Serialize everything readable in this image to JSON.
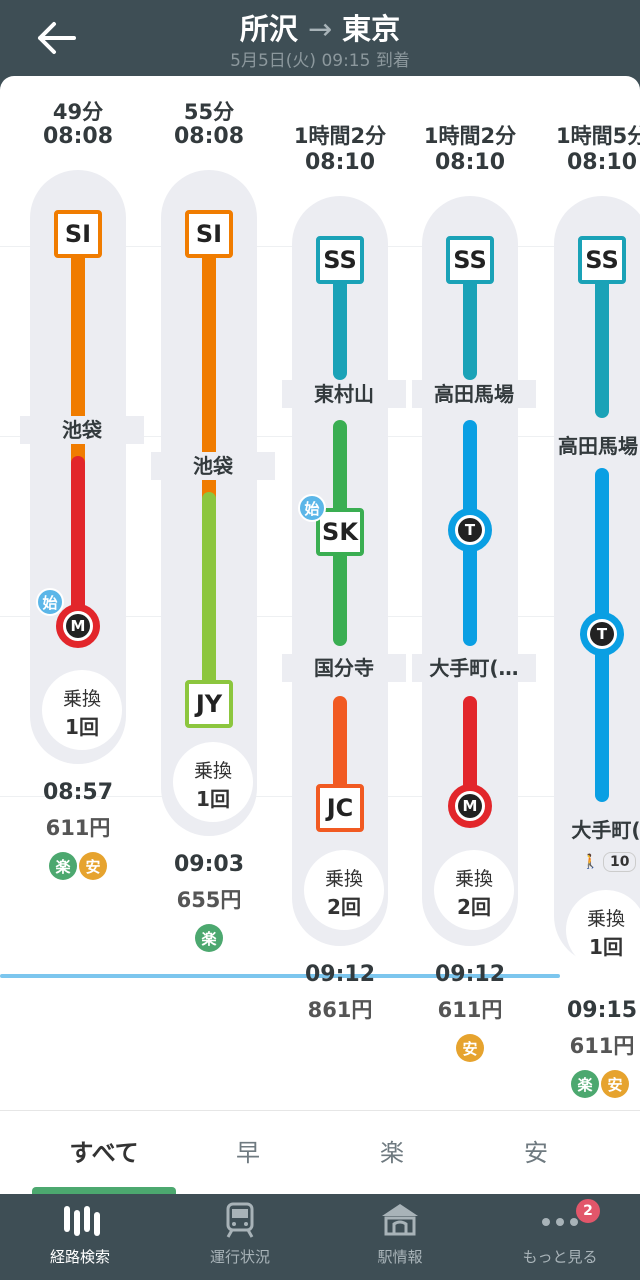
{
  "header": {
    "from": "所沢",
    "to": "東京",
    "arrow": "→",
    "subline": "5月5日(火) 09:15 到着"
  },
  "routes": [
    {
      "duration": "49分",
      "depart": "08:08",
      "badges": [
        "SI",
        "M"
      ],
      "stations": [
        "池袋"
      ],
      "shi": "始",
      "transfer_label": "乗換",
      "transfer_count": "1回",
      "arrive": "08:57",
      "fare": "611円",
      "tags": [
        "楽",
        "安"
      ]
    },
    {
      "duration": "55分",
      "depart": "08:08",
      "badges": [
        "SI",
        "JY"
      ],
      "stations": [
        "池袋"
      ],
      "transfer_label": "乗換",
      "transfer_count": "1回",
      "arrive": "09:03",
      "fare": "655円",
      "tags": [
        "楽"
      ]
    },
    {
      "duration": "1時間2分",
      "depart": "08:10",
      "badges": [
        "SS",
        "SK",
        "JC"
      ],
      "stations": [
        "東村山",
        "国分寺"
      ],
      "shi": "始",
      "transfer_label": "乗換",
      "transfer_count": "2回",
      "arrive": "09:12",
      "fare": "861円",
      "tags": []
    },
    {
      "duration": "1時間2分",
      "depart": "08:10",
      "badges": [
        "SS",
        "T",
        "M"
      ],
      "stations": [
        "高田馬場",
        "大手町(…"
      ],
      "transfer_label": "乗換",
      "transfer_count": "2回",
      "arrive": "09:12",
      "fare": "611円",
      "tags": [
        "安"
      ]
    },
    {
      "duration": "1時間5分",
      "depart": "08:10",
      "badges": [
        "SS",
        "T"
      ],
      "stations": [
        "高田馬場",
        "大手町(…"
      ],
      "walk": "10",
      "transfer_label": "乗換",
      "transfer_count": "1回",
      "arrive": "09:15",
      "fare": "611円",
      "tags": [
        "楽",
        "安"
      ]
    }
  ],
  "filter_tabs": [
    "すべて",
    "早",
    "楽",
    "安"
  ],
  "active_filter": "すべて",
  "bottom_nav": [
    {
      "label": "経路検索",
      "icon": "route-search-icon"
    },
    {
      "label": "運行状況",
      "icon": "train-icon"
    },
    {
      "label": "駅情報",
      "icon": "station-icon"
    },
    {
      "label": "もっと見る",
      "icon": "more-icon",
      "badge": "2"
    }
  ],
  "colors": {
    "seibu_ikebukuro": "#f07c00",
    "marunouchi": "#e2262b",
    "yamanote": "#8cc63e",
    "seibu_shinjuku": "#1aa2b7",
    "kokubunji": "#3aae52",
    "chuo": "#f15a22",
    "tozai": "#0a9fe3",
    "raku_tag": "#4ca86f",
    "yasu_tag": "#e6a32e"
  }
}
